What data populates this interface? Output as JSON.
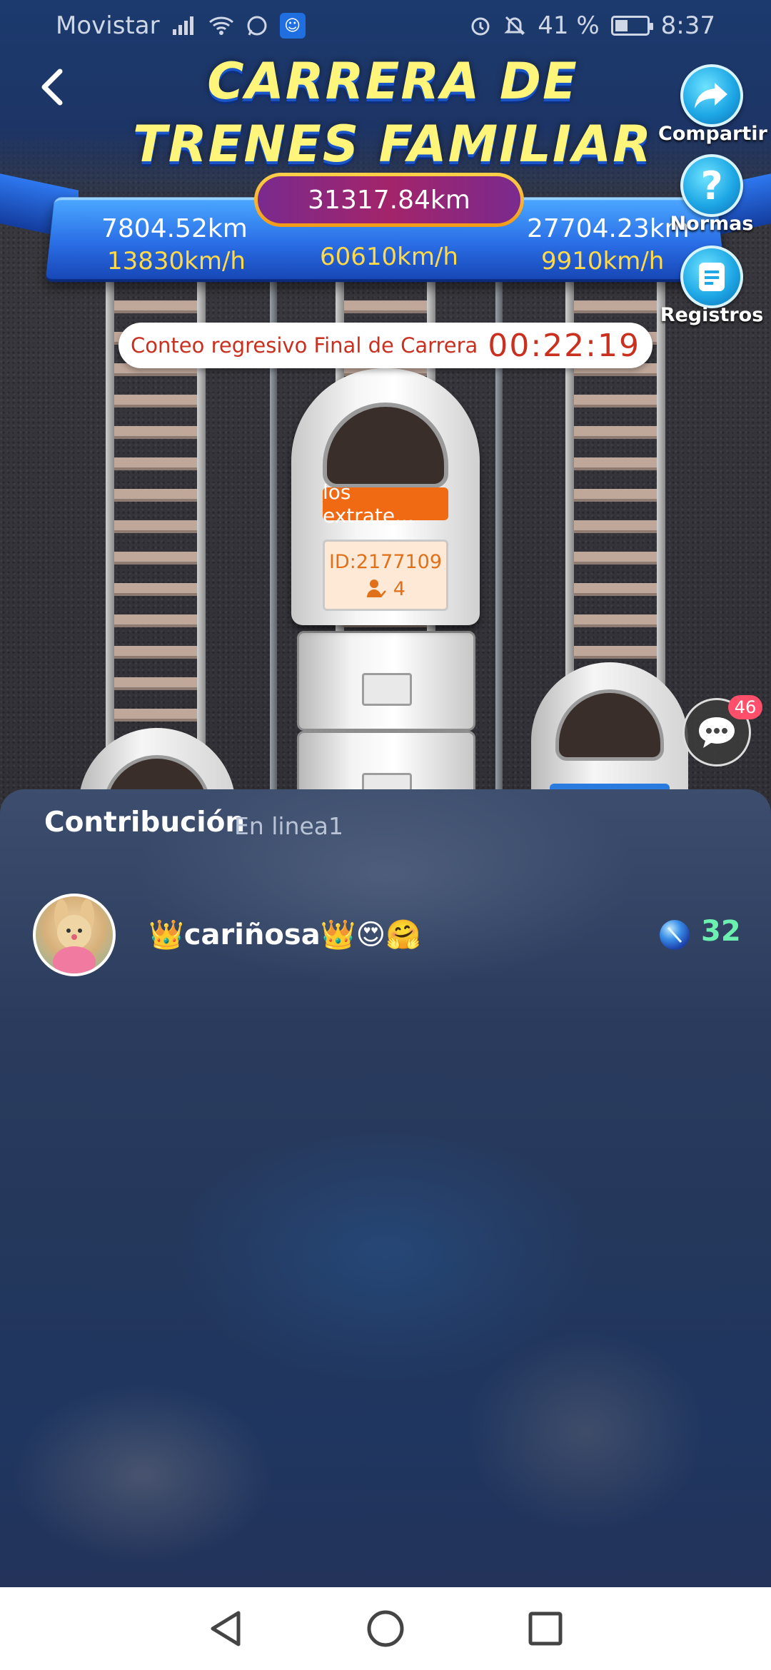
{
  "status_bar": {
    "carrier": "Movistar",
    "battery_percent": "41 %",
    "battery_level": 0.41,
    "time": "8:37",
    "icons": [
      "signal-icon",
      "wifi-icon",
      "whatsapp-icon",
      "app-notification-icon",
      "alarm-icon",
      "mute-icon",
      "battery-icon"
    ]
  },
  "header": {
    "title_line1": "CARRERA DE",
    "title_line2": "TRENES FAMILIAR"
  },
  "scoreboard": {
    "total_distance": "31317.84km",
    "left": {
      "distance": "7804.52km",
      "speed": "13830km/h"
    },
    "center": {
      "speed": "60610km/h"
    },
    "right": {
      "distance": "27704.23km",
      "speed": "9910km/h"
    }
  },
  "countdown": {
    "label": "Conteo regresivo Final de Carrera",
    "time": "00:22:19"
  },
  "side_actions": {
    "share": "Compartir",
    "rules": "Normas",
    "records": "Registros"
  },
  "train": {
    "name": "los extrate...",
    "id": "ID:2177109",
    "members": "4"
  },
  "chat": {
    "badge": "46"
  },
  "contribution": {
    "title": "Contribución",
    "online": "En linea1",
    "rows": [
      {
        "name": "👑cariñosa👑😍🤗",
        "value": "32"
      }
    ]
  },
  "colors": {
    "accent_title": "#fff57a",
    "countdown_red": "#c9301f",
    "value_green": "#6cf0b0",
    "train_tag_orange": "#f06a14"
  }
}
